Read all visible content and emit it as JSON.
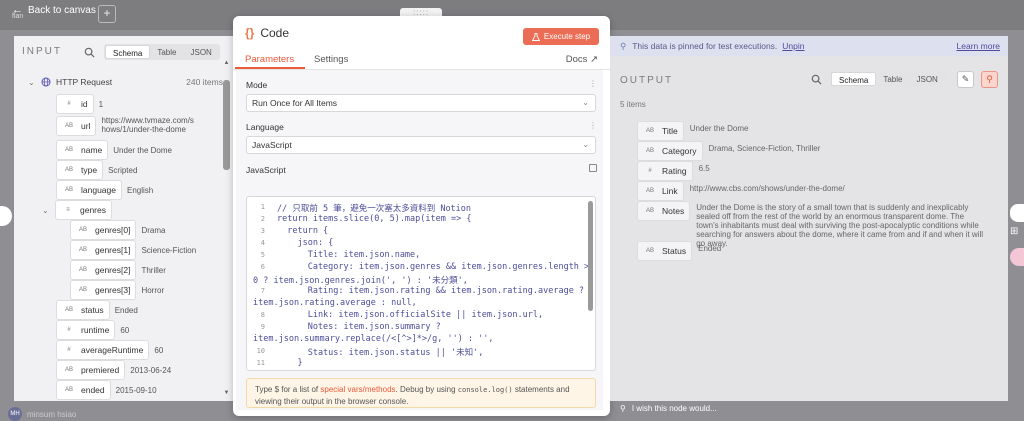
{
  "canvas": {
    "back_label": "Back to canvas",
    "workspace_label": "flan",
    "user_name": "minsum hsiao",
    "user_initials": "MH"
  },
  "input": {
    "heading": "INPUT",
    "view_tabs": [
      "Schema",
      "Table",
      "JSON"
    ],
    "active_tab": "Schema",
    "root": {
      "label": "HTTP Request",
      "count": "240 items"
    },
    "fields": [
      {
        "type": "#",
        "key": "id",
        "value": "1"
      },
      {
        "type": "AB",
        "key": "url",
        "value": "https://www.tvmaze.com/shows/1/under-the-dome"
      },
      {
        "type": "AB",
        "key": "name",
        "value": "Under the Dome"
      },
      {
        "type": "AB",
        "key": "type",
        "value": "Scripted"
      },
      {
        "type": "AB",
        "key": "language",
        "value": "English"
      }
    ],
    "genres": {
      "key": "genres",
      "items": [
        {
          "key": "genres[0]",
          "value": "Drama"
        },
        {
          "key": "genres[1]",
          "value": "Science-Fiction"
        },
        {
          "key": "genres[2]",
          "value": "Thriller"
        },
        {
          "key": "genres[3]",
          "value": "Horror"
        }
      ]
    },
    "fields2": [
      {
        "type": "AB",
        "key": "status",
        "value": "Ended"
      },
      {
        "type": "#",
        "key": "runtime",
        "value": "60"
      },
      {
        "type": "#",
        "key": "averageRuntime",
        "value": "60"
      },
      {
        "type": "AB",
        "key": "premiered",
        "value": "2013-06-24"
      },
      {
        "type": "AB",
        "key": "ended",
        "value": "2015-09-10"
      }
    ]
  },
  "modal": {
    "title": "Code",
    "execute_label": "Execute step",
    "tabs": [
      "Parameters",
      "Settings"
    ],
    "docs_label": "Docs",
    "mode_label": "Mode",
    "mode_value": "Run Once for All Items",
    "language_label": "Language",
    "language_value": "JavaScript",
    "code_label": "JavaScript",
    "code_lines": [
      {
        "n": "1",
        "text": "// 只取前 5 筆，避免一次塞太多資料到 Notion"
      },
      {
        "n": "2",
        "text": "return items.slice(0, 5).map(item => {"
      },
      {
        "n": "3",
        "text": "  return {"
      },
      {
        "n": "4",
        "text": "    json: {"
      },
      {
        "n": "5",
        "text": "      Title: item.json.name,"
      },
      {
        "n": "6",
        "text": "      Category: item.json.genres && item.json.genres.length >"
      },
      {
        "n": "",
        "text": "0 ? item.json.genres.join(', ') : '未分類',"
      },
      {
        "n": "7",
        "text": "      Rating: item.json.rating && item.json.rating.average ?"
      },
      {
        "n": "",
        "text": "item.json.rating.average : null,"
      },
      {
        "n": "8",
        "text": "      Link: item.json.officialSite || item.json.url,"
      },
      {
        "n": "9",
        "text": "      Notes: item.json.summary ?"
      },
      {
        "n": "",
        "text": "item.json.summary.replace(/<[^>]*>/g, '') : '',"
      },
      {
        "n": "10",
        "text": "      Status: item.json.status || '未知',"
      },
      {
        "n": "11",
        "text": "    }"
      }
    ],
    "hint_prefix": "Type $ for a list of ",
    "hint_link": "special vars/methods",
    "hint_mid": ". Debug by using ",
    "hint_code": "console.log()",
    "hint_suffix": " statements and",
    "hint_line2": "viewing their output in the browser console."
  },
  "output": {
    "pin_text": "This data is pinned for test executions.",
    "unpin_label": "Unpin",
    "learn_more_label": "Learn more",
    "heading": "OUTPUT",
    "items_count": "5 items",
    "view_tabs": [
      "Schema",
      "Table",
      "JSON"
    ],
    "active_tab": "Schema",
    "fields": [
      {
        "type": "AB",
        "key": "Title",
        "value": "Under the Dome"
      },
      {
        "type": "AB",
        "key": "Category",
        "value": "Drama, Science-Fiction, Thriller"
      },
      {
        "type": "#",
        "key": "Rating",
        "value": "6.5"
      },
      {
        "type": "AB",
        "key": "Link",
        "value": "http://www.cbs.com/shows/under-the-dome/"
      },
      {
        "type": "AB",
        "key": "Notes",
        "value": "Under the Dome is the story of a small town that is suddenly and inexplicably sealed off from the rest of the world by an enormous transparent dome. The town's inhabitants must deal with surviving the post-apocalyptic conditions while searching for answers about the dome, where it came from and if and when it will go away."
      },
      {
        "type": "AB",
        "key": "Status",
        "value": "Ended"
      }
    ]
  },
  "feedback_label": "I wish this node would..."
}
